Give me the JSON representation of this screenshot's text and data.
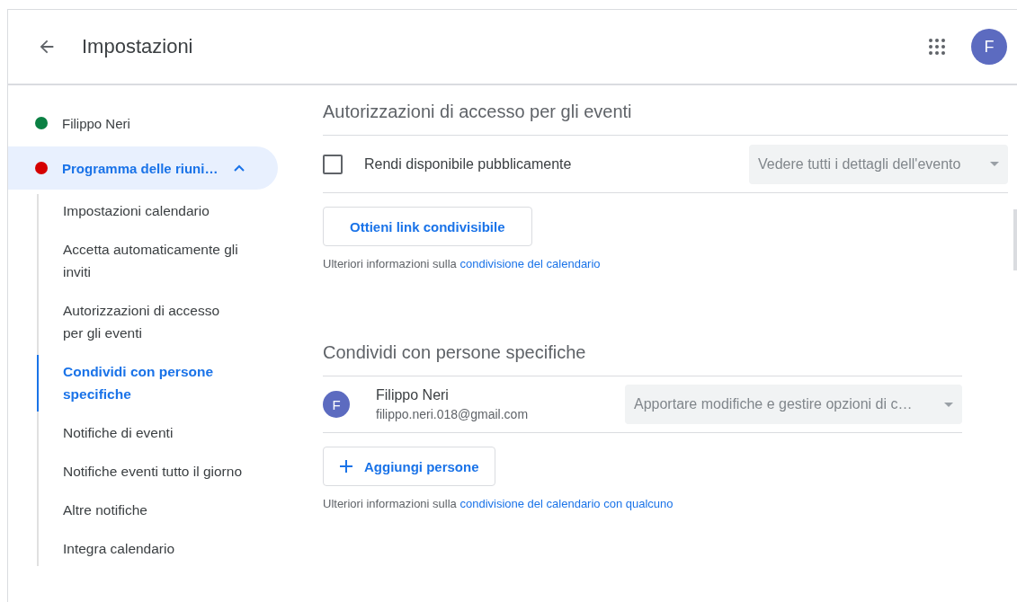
{
  "header": {
    "title": "Impostazioni",
    "avatar": "F"
  },
  "sidebar": {
    "calendars": [
      {
        "name": "Filippo Neri",
        "color": "#0b8043",
        "selected": false
      },
      {
        "name": "Programma delle riuni…",
        "color": "#d50000",
        "selected": true,
        "expanded": true,
        "children": [
          {
            "label": "Impostazioni calendario",
            "selected": false
          },
          {
            "label": "Accetta automaticamente gli inviti",
            "selected": false
          },
          {
            "label": "Autorizzazioni di accesso per gli eventi",
            "selected": false
          },
          {
            "label": "Condividi con persone specifiche",
            "selected": true
          },
          {
            "label": "Notifiche di eventi",
            "selected": false
          },
          {
            "label": "Notifiche eventi tutto il giorno",
            "selected": false
          },
          {
            "label": "Altre notifiche",
            "selected": false
          },
          {
            "label": "Integra calendario",
            "selected": false
          }
        ]
      }
    ]
  },
  "access": {
    "title": "Autorizzazioni di accesso per gli eventi",
    "public_label": "Rendi disponibile pubblicamente",
    "checked": false,
    "dropdown": "Vedere tutti i dettagli dell'evento",
    "button": "Ottieni link condivisibile",
    "info_text": "Ulteriori informazioni sulla",
    "info_link": "condivisione del calendario"
  },
  "share": {
    "title": "Condividi con persone specifiche",
    "people": [
      {
        "avatar": "F",
        "name": "Filippo Neri",
        "email": "filippo.neri.018@gmail.com",
        "permission": "Apportare modifiche e gestire opzioni di c…"
      }
    ],
    "button": "Aggiungi persone",
    "info_text": "Ulteriori informazioni sulla",
    "info_link": "condivisione del calendario con qualcuno"
  }
}
